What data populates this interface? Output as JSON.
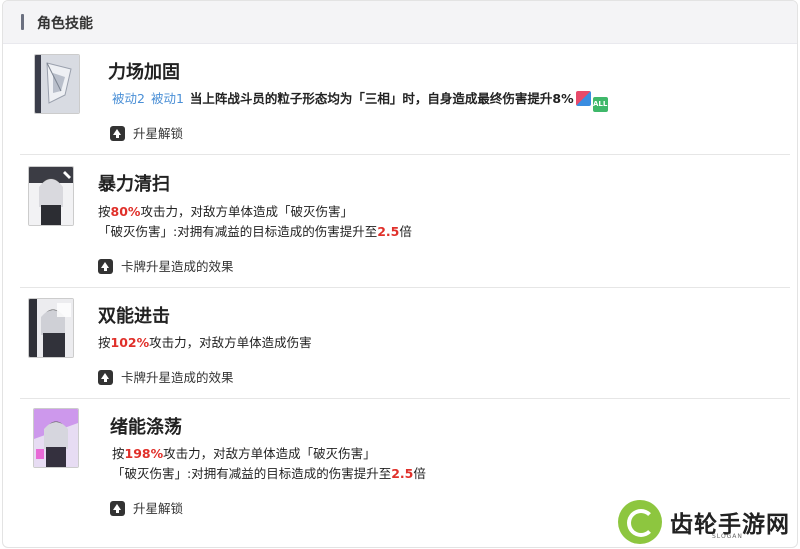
{
  "header": {
    "title": "角色技能"
  },
  "skills": [
    {
      "name": "力场加固",
      "tags": [
        "被动2",
        "被动1"
      ],
      "line1": {
        "pre": "当上阵战斗员的粒子形态均为「三相」时，自身造成最终伤害提升",
        "value": "8%"
      },
      "action": "升星解锁"
    },
    {
      "name": "暴力清扫",
      "line1": {
        "pre": "按",
        "value": "80%",
        "post": "攻击力，对敌方单体造成「破灭伤害」"
      },
      "line2": {
        "pre": "「破灭伤害」:对拥有减益的目标造成的伤害提升至",
        "value": "2.5",
        "post": "倍"
      },
      "action": "卡牌升星造成的效果"
    },
    {
      "name": "双能进击",
      "line1": {
        "pre": "按",
        "value": "102%",
        "post": "攻击力，对敌方单体造成伤害"
      },
      "action": "卡牌升星造成的效果"
    },
    {
      "name": "绪能涤荡",
      "line1": {
        "pre": "按",
        "value": "198%",
        "post": "攻击力，对敌方单体造成「破灭伤害」"
      },
      "line2": {
        "pre": "「破灭伤害」:对拥有减益的目标造成的伤害提升至",
        "value": "2.5",
        "post": "倍"
      },
      "action": "升星解锁"
    }
  ],
  "badges": {
    "all": "ALL"
  },
  "watermark": {
    "name": "齿轮手游网",
    "slogan": "SLOGAN"
  },
  "colors": {
    "highlight": "#e0302a",
    "tag": "#4a8fd6",
    "logo": "#8dc63f"
  }
}
